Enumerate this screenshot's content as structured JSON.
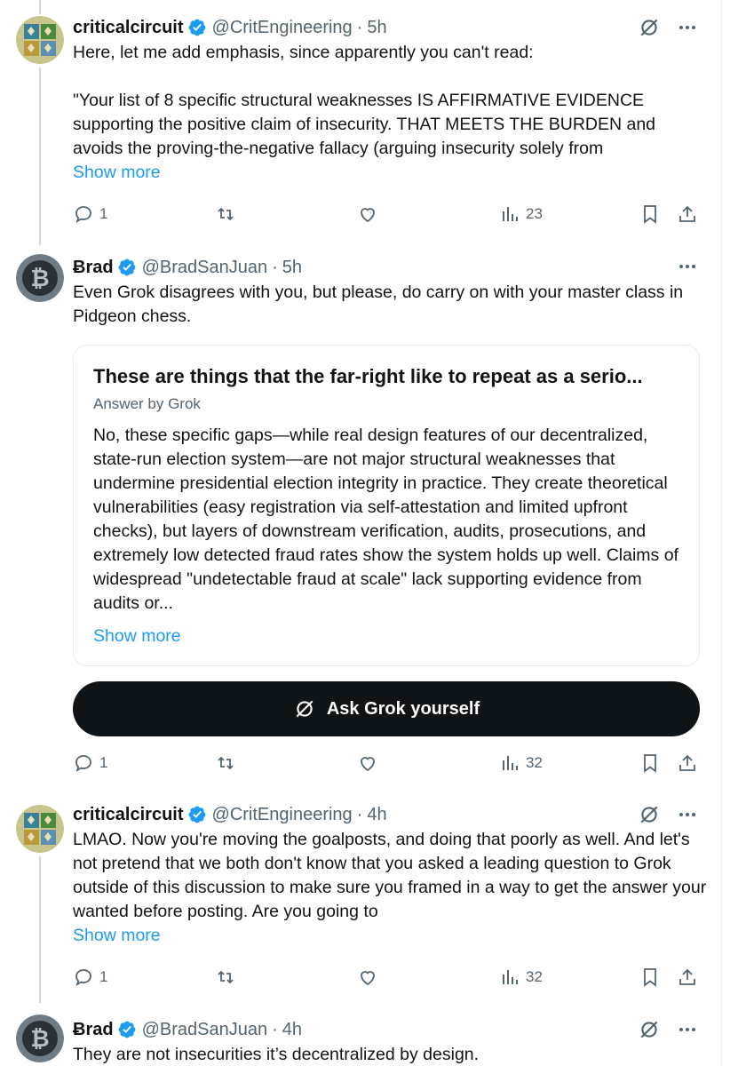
{
  "colors": {
    "accent": "#1d9bf0",
    "muted": "#536471",
    "text": "#0f1419"
  },
  "tweets": [
    {
      "name": "criticalcircuit",
      "handle": "@CritEngineering",
      "dot": "·",
      "time": "5h",
      "text": "Here, let me add emphasis, since apparently you can't read:\n\n\"Your list of 8 specific structural weaknesses IS AFFIRMATIVE EVIDENCE supporting the positive claim of insecurity. THAT MEETS THE BURDEN and avoids the proving-the-negative fallacy (arguing insecurity solely from",
      "show_more": "Show more",
      "replies": "1",
      "views": "23"
    },
    {
      "name": "Ƀrad",
      "handle": "@BradSanJuan",
      "dot": "·",
      "time": "5h",
      "text": "Even Grok disagrees with you, but please, do carry on with your master class in Pidgeon chess.",
      "grok_card": {
        "title": "These are things that the far-right like to repeat as a serio...",
        "subtitle": "Answer by Grok",
        "body": "No, these specific gaps—while real design features of our decentralized, state-run election system—are not major structural weaknesses that undermine presidential election integrity in practice. They create theoretical vulnerabilities (easy registration via self-attestation and limited upfront checks), but layers of downstream verification, audits, prosecutions, and extremely low detected fraud rates show the system holds up well. Claims of widespread \"undetectable fraud at scale\" lack supporting evidence from audits or...",
        "show_more": "Show more"
      },
      "ask_button": "Ask Grok yourself",
      "replies": "1",
      "views": "32"
    },
    {
      "name": "criticalcircuit",
      "handle": "@CritEngineering",
      "dot": "·",
      "time": "4h",
      "text": "LMAO. Now you're moving the goalposts, and doing that poorly as well. And let's not pretend that we both don't know that you asked a leading question to Grok outside of this discussion to make sure you framed in a way to get the answer your wanted before posting. Are you going to",
      "show_more": "Show more",
      "replies": "1",
      "views": "32"
    },
    {
      "name": "Ƀrad",
      "handle": "@BradSanJuan",
      "dot": "·",
      "time": "4h",
      "text": "They are not insecurities it’s decentralized by design."
    }
  ]
}
